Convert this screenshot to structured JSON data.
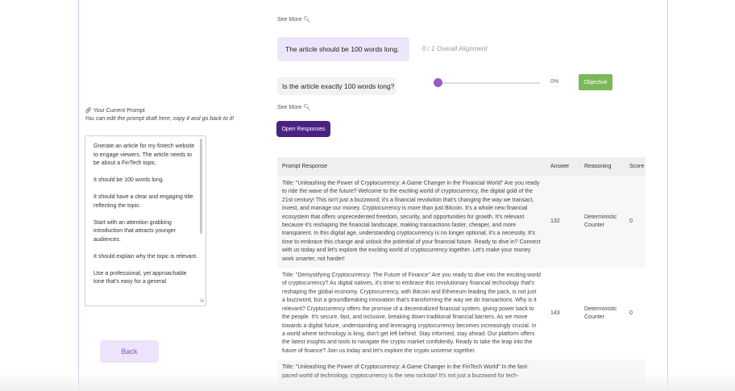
{
  "colors": {
    "accent_purple": "#4a2382",
    "objective_green": "#7ab85a",
    "statement_bg": "#ede6fb",
    "back_button_bg": "#ece4fa",
    "back_button_text": "#7b5cc4",
    "slider_thumb": "#9b59c9"
  },
  "icons": {
    "see_more": "magnifier-icon",
    "prompt": "link-icon"
  },
  "criteria": {
    "see_more_label": "See More",
    "statement": "The article should be 100 words long.",
    "overall_alignment": "0 / 1 Overall Alignment",
    "question": "Is the article exactly 100 words long?",
    "slider_value": 0,
    "slider_percent": "0%",
    "objective_label": "Objective",
    "open_responses_label": "Open Responses"
  },
  "prompt_panel": {
    "title": "Your Current Prompt",
    "subtitle": "You can edit the prompt draft here, copy it and go back to it!",
    "text": "Gnerate an article for my fintech website to engage viewers. The article needs to be about a FinTech topic.\n\nIt should be 100 words long.\n\nIt should have a clear and engaging title reflecting the topic.\n\nStart with an attention grabbing introduction that attracts younger audiences.\n\nIt should explain why the topic is relevant.\n\nUse a professional, yet approachable tone that's easy for a general",
    "back_label": "Back"
  },
  "table": {
    "headers": [
      "Prompt Response",
      "Answer",
      "Reasoning",
      "Score"
    ],
    "rows": [
      {
        "response": "Title: \"Unleashing the Power of Cryptocurrency: A Game Changer in the Financial World\" Are you ready to ride the wave of the future? Welcome to the exciting world of cryptocurrency, the digital gold of the 21st century! This isn't just a buzzword; it's a financial revolution that's changing the way we transact, invest, and manage our money. Cryptocurrency is more than just Bitcoin. It's a whole new financial ecosystem that offers unprecedented freedom, security, and opportunities for growth. It's relevant because it's reshaping the financial landscape, making transactions faster, cheaper, and more transparent. In this digital age, understanding cryptocurrency is no longer optional; it's a necessity. It's time to embrace this change and unlock the potential of your financial future. Ready to dive in? Connect with us today and let's explore the exciting world of cryptocurrency together. Let's make your money work smarter, not harder!",
        "answer": "132",
        "reasoning": "Deterministic Counter",
        "score": "0"
      },
      {
        "response": "Title: \"Demystifying Cryptocurrency: The Future of Finance\" Are you ready to dive into the exciting world of cryptocurrency? As digital natives, it's time to embrace this revolutionary financial technology that's reshaping the global economy. Cryptocurrency, with Bitcoin and Ethereum leading the pack, is not just a buzzword, but a groundbreaking innovation that's transforming the way we do transactions. Why is it relevant? Cryptocurrency offers the promise of a decentralized financial system, giving power back to the people. It's secure, fast, and inclusive, breaking down traditional financial barriers. As we move towards a digital future, understanding and leveraging cryptocurrency becomes increasingly crucial. In a world where technology is king, don't get left behind. Stay informed, stay ahead. Our platform offers the latest insights and tools to navigate the crypto market confidently. Ready to take the leap into the future of finance? Join us today and let's explore the crypto universe together.",
        "answer": "143",
        "reasoning": "Deterministic Counter",
        "score": "0"
      },
      {
        "response": "Title: \"Unleashing the Power of Cryptocurrency: A Game Changer in the FinTech World\" In the fast-paced world of technology, cryptocurrency is the new rockstar! It's not just a buzzword for tech-",
        "answer": "",
        "reasoning": "",
        "score": ""
      }
    ]
  }
}
